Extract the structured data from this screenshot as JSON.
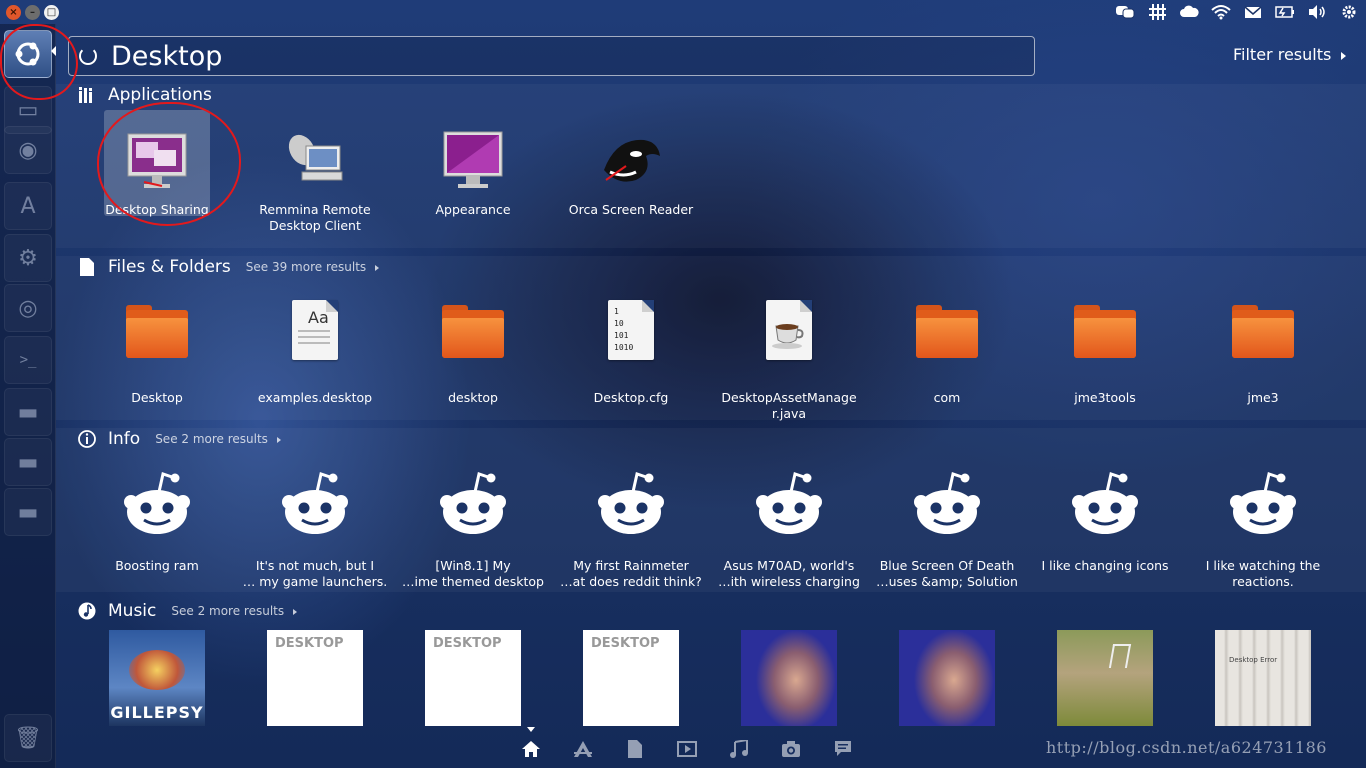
{
  "window_controls": {
    "close": "×",
    "minimize": "–",
    "maximize": "□"
  },
  "indicators": [
    "chat-icon",
    "network-grid-icon",
    "cloud-icon",
    "wifi-icon",
    "mail-icon",
    "battery-icon",
    "volume-icon",
    "settings-gear-icon"
  ],
  "launcher": {
    "items": [
      "ubuntu-dash-icon",
      "files-icon",
      "firefox-icon",
      "font-icon",
      "settings-icon",
      "ubuntu-one-icon",
      "terminal-icon",
      "drive-icon",
      "drive-icon",
      "drive-icon",
      "trash-icon"
    ]
  },
  "search": {
    "query": "Desktop",
    "filter_label": "Filter results"
  },
  "applications": {
    "title": "Applications",
    "items": [
      {
        "label": "Desktop Sharing",
        "icon": "desktop-sharing-icon"
      },
      {
        "label": "Remmina Remote\nDesktop Client",
        "icon": "remmina-icon"
      },
      {
        "label": "Appearance",
        "icon": "appearance-icon"
      },
      {
        "label": "Orca Screen Reader",
        "icon": "orca-icon"
      }
    ]
  },
  "files": {
    "title": "Files & Folders",
    "more": "See 39 more results",
    "items": [
      {
        "label": "Desktop",
        "icon": "folder-icon"
      },
      {
        "label": "examples.desktop",
        "icon": "text-document-icon",
        "icon_text": "Aa"
      },
      {
        "label": "desktop",
        "icon": "folder-icon"
      },
      {
        "label": "Desktop.cfg",
        "icon": "binary-document-icon",
        "icon_text": "1\n10\n101\n1010"
      },
      {
        "label": "DesktopAssetManage\nr.java",
        "icon": "java-document-icon"
      },
      {
        "label": "com",
        "icon": "folder-icon"
      },
      {
        "label": "jme3tools",
        "icon": "folder-icon"
      },
      {
        "label": "jme3",
        "icon": "folder-icon"
      }
    ]
  },
  "info": {
    "title": "Info",
    "more": "See 2 more results",
    "items": [
      {
        "label": "Boosting ram"
      },
      {
        "label": "It's not much, but I\n… my game launchers."
      },
      {
        "label": "[Win8.1] My\n…ime themed desktop"
      },
      {
        "label": "My first Rainmeter\n…at does reddit think?"
      },
      {
        "label": "Asus M70AD, world's\n…ith wireless charging"
      },
      {
        "label": "Blue Screen Of Death\n…uses &amp; Solution"
      },
      {
        "label": "I like changing icons"
      },
      {
        "label": "I like watching the\nreactions."
      }
    ]
  },
  "music": {
    "title": "Music",
    "more": "See 2 more results",
    "albums": [
      {
        "type": "art",
        "text": "GILLEPSY",
        "colors": [
          "#3c6fb5",
          "#e8e0d0"
        ]
      },
      {
        "type": "placeholder",
        "text": "DESKTOP"
      },
      {
        "type": "placeholder",
        "text": "DESKTOP"
      },
      {
        "type": "placeholder",
        "text": "DESKTOP"
      },
      {
        "type": "photo",
        "colors": [
          "#2b2f9a",
          "#d9a890"
        ]
      },
      {
        "type": "photo",
        "colors": [
          "#2b2f9a",
          "#d9a890"
        ]
      },
      {
        "type": "photo",
        "colors": [
          "#7d8a3a",
          "#b4a37d"
        ]
      },
      {
        "type": "photo",
        "text": "Desktop Error",
        "colors": [
          "#d8d5d0",
          "#8a8680"
        ]
      }
    ]
  },
  "lenses": [
    "home-icon",
    "applications-icon",
    "files-icon",
    "video-icon",
    "music-icon",
    "photo-icon",
    "social-icon"
  ],
  "watermark": "http://blog.csdn.net/a624731186",
  "colors": {
    "annotation": "#e3191c",
    "folder_orange": "#e8641e",
    "accent": "#ffffff"
  }
}
